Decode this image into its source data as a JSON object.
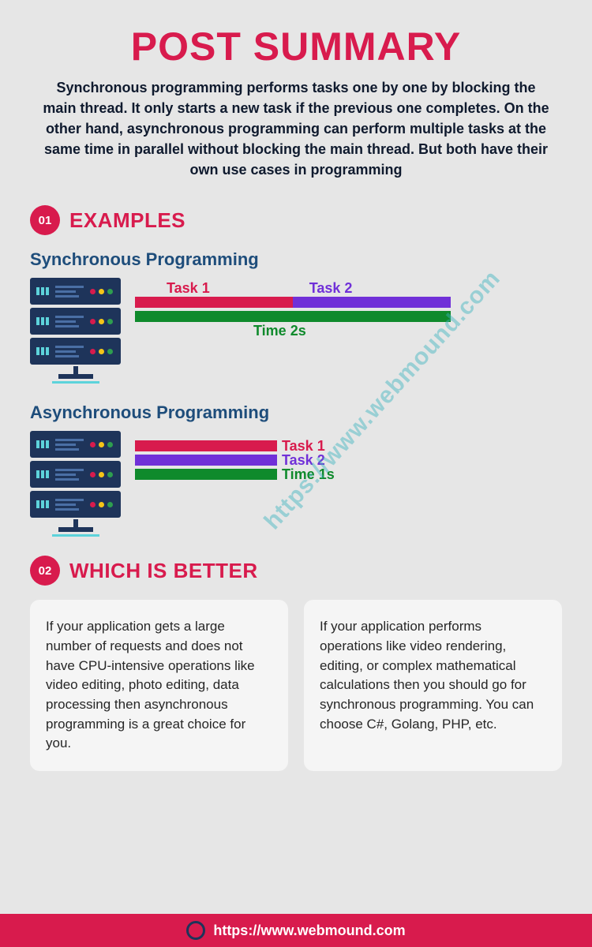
{
  "title": "POST SUMMARY",
  "summary": "Synchronous programming performs tasks one by one by blocking the main thread. It only starts a new task if the previous one completes. On the other hand, asynchronous programming can perform multiple tasks at the same time in parallel without blocking the main thread. But both have their own use cases in programming",
  "section1": {
    "badge": "01",
    "title": "EXAMPLES"
  },
  "sync": {
    "heading": "Synchronous Programming",
    "task1": "Task 1",
    "task2": "Task 2",
    "time": "Time 2s"
  },
  "async": {
    "heading": "Asynchronous Programming",
    "task1": "Task 1",
    "task2": "Task 2",
    "time": "Time 1s"
  },
  "section2": {
    "badge": "02",
    "title": "WHICH IS BETTER"
  },
  "boxes": {
    "left": "If your application gets a large number of requests and does not have CPU-intensive operations like video editing, photo editing, data processing then asynchronous programming is a great choice for you.",
    "right": "If your application performs operations like video rendering, editing, or complex mathematical calculations then you should go for synchronous programming. You can choose C#, Golang, PHP, etc."
  },
  "watermark": "https://www.webmound.com",
  "footer_url": "https://www.webmound.com"
}
